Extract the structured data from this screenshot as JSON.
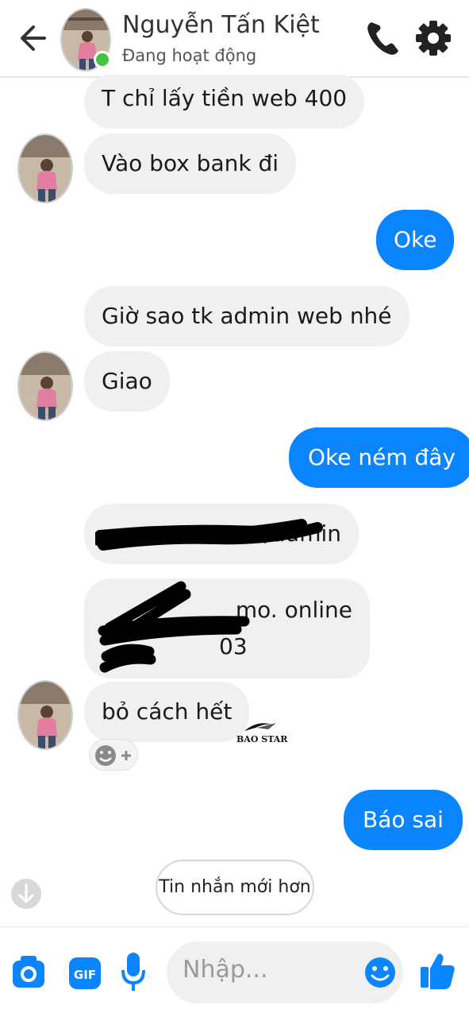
{
  "header": {
    "contact_name": "Nguyễn Tấn Kiệt",
    "status": "Đang hoạt động",
    "icons": [
      "back-arrow-icon",
      "avatar",
      "phone-icon",
      "gear-icon"
    ]
  },
  "messages": [
    {
      "side": "in",
      "text": "T chỉ lấy tiền web 400"
    },
    {
      "side": "in",
      "text": "Vào box bank đi"
    },
    {
      "side": "out",
      "text": "Oke"
    },
    {
      "side": "in",
      "text": "Giờ sao tk admin web nhé"
    },
    {
      "side": "in",
      "text": "Giao"
    },
    {
      "side": "out",
      "text": "Oke ném đây"
    },
    {
      "side": "in",
      "text": "/admin",
      "redacted": true
    },
    {
      "side": "in",
      "line1": "mo. online",
      "line2": "03",
      "redacted": true
    },
    {
      "side": "in",
      "text": "bỏ cách hết"
    },
    {
      "side": "out",
      "text": "Báo sai"
    }
  ],
  "watermark": "BAO STAR",
  "newer_messages_label": "Tin nhắn mới hơn",
  "composer": {
    "placeholder": "Nhập...",
    "icons": [
      "camera-icon",
      "gif-icon",
      "microphone-icon",
      "emoji-icon",
      "thumbs-up-icon"
    ]
  },
  "colors": {
    "accent": "#0a84ff",
    "incoming_bubble": "#f0f0f0",
    "online": "#44c244"
  }
}
